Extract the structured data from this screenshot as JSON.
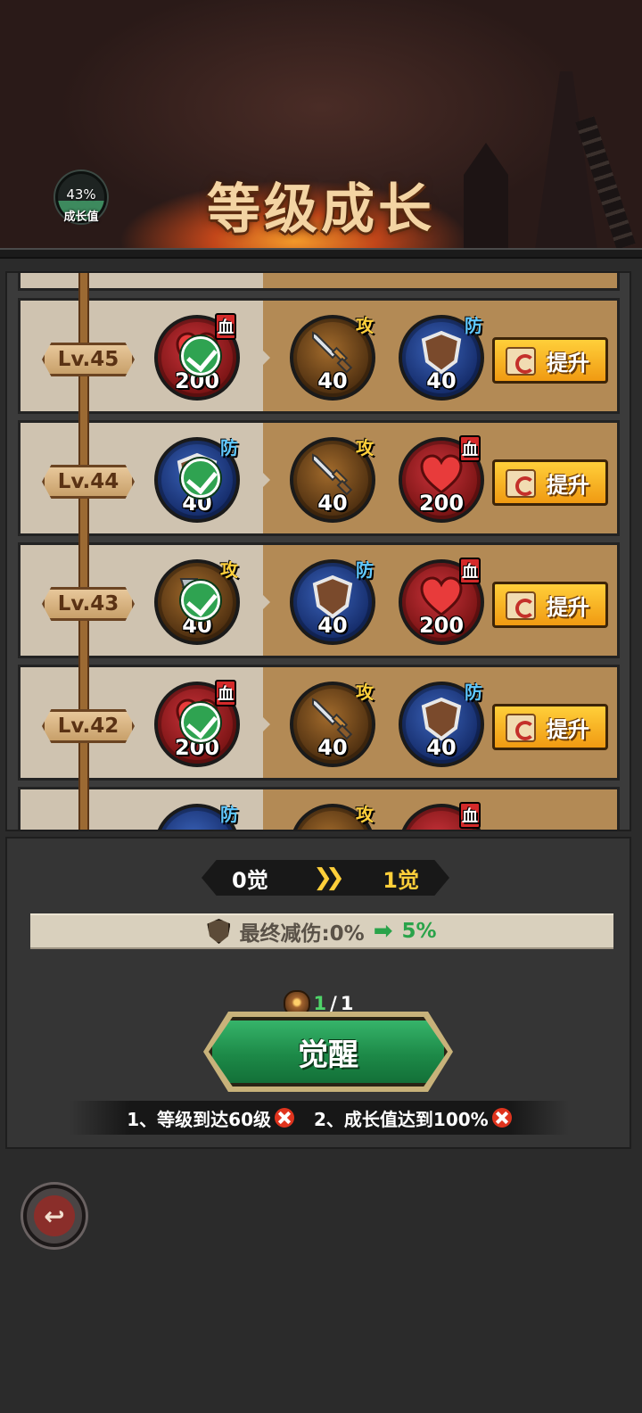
{
  "header": {
    "title": "等级成长",
    "growth_percent": "43%",
    "growth_value": 0.43,
    "growth_label": "成长值"
  },
  "levels": [
    {
      "level": "Lv.45",
      "main": {
        "type": "hp",
        "tag": "血",
        "value": "200",
        "claimed": true
      },
      "rewards": [
        {
          "type": "atk",
          "tag": "攻",
          "value": "40"
        },
        {
          "type": "def",
          "tag": "防",
          "value": "40"
        }
      ],
      "button": "提升"
    },
    {
      "level": "Lv.44",
      "main": {
        "type": "def",
        "tag": "防",
        "value": "40",
        "claimed": true
      },
      "rewards": [
        {
          "type": "atk",
          "tag": "攻",
          "value": "40"
        },
        {
          "type": "hp",
          "tag": "血",
          "value": "200"
        }
      ],
      "button": "提升"
    },
    {
      "level": "Lv.43",
      "main": {
        "type": "atk",
        "tag": "攻",
        "value": "40",
        "claimed": true
      },
      "rewards": [
        {
          "type": "def",
          "tag": "防",
          "value": "40"
        },
        {
          "type": "hp",
          "tag": "血",
          "value": "200"
        }
      ],
      "button": "提升"
    },
    {
      "level": "Lv.42",
      "main": {
        "type": "hp",
        "tag": "血",
        "value": "200",
        "claimed": true
      },
      "rewards": [
        {
          "type": "atk",
          "tag": "攻",
          "value": "40"
        },
        {
          "type": "def",
          "tag": "防",
          "value": "40"
        }
      ],
      "button": "提升"
    }
  ],
  "partial_row_tags": {
    "left": "防",
    "mid": "攻",
    "right": "血"
  },
  "awaken": {
    "from": "0觉",
    "to": "1觉",
    "bonus_label": "最终减伤:0%",
    "bonus_next": "5%",
    "cost_have": "1",
    "cost_sep": "/",
    "cost_need": "1",
    "button": "觉醒",
    "conditions": [
      "1、等级到达60级",
      "2、成长值达到100%"
    ]
  },
  "colors": {
    "hp": "#c8323a",
    "def": "#2c4e9a",
    "atk": "#a26b2c",
    "upgrade_button": "#f5b020",
    "awaken_button": "#1f8f4b",
    "positive": "#2aa34a"
  },
  "icons": {
    "upgrade": "scroll-icon",
    "back": "back-arrow-icon",
    "cost": "awaken-stone-icon",
    "bonus": "shield-icon"
  }
}
